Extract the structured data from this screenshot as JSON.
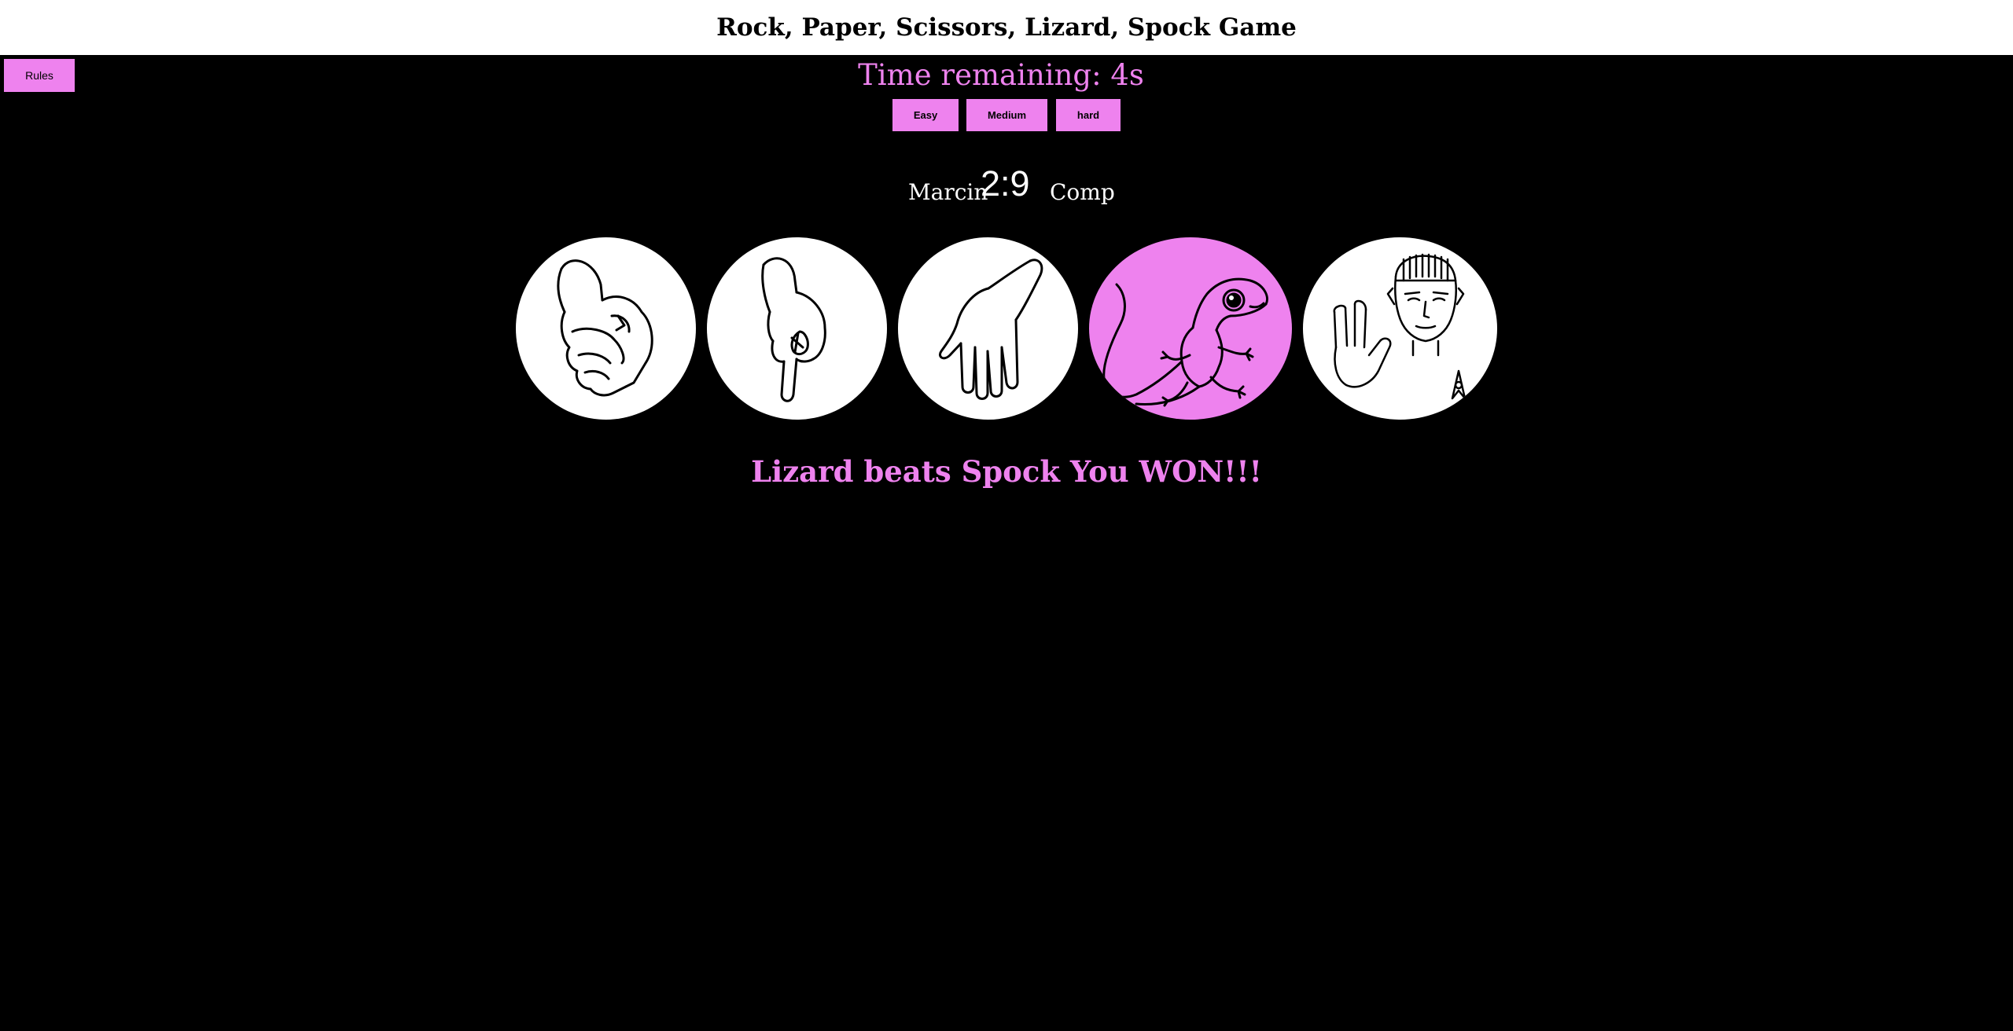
{
  "header": {
    "title": "Rock, Paper, Scissors, Lizard, Spock Game"
  },
  "rules_button": {
    "label": "Rules"
  },
  "timer": {
    "text": "Time remaining: 4s"
  },
  "difficulty": {
    "easy": "Easy",
    "medium": "Medium",
    "hard": "hard"
  },
  "scoreboard": {
    "player": "Marcin",
    "score": "2:9",
    "computer": "Comp"
  },
  "choices": [
    {
      "id": "rock",
      "icon": "fist-icon",
      "selected": false
    },
    {
      "id": "scissors",
      "icon": "scissors-hand-icon",
      "selected": false
    },
    {
      "id": "paper",
      "icon": "open-hand-icon",
      "selected": false
    },
    {
      "id": "lizard",
      "icon": "lizard-icon",
      "selected": true
    },
    {
      "id": "spock",
      "icon": "spock-icon",
      "selected": false
    }
  ],
  "result": {
    "text": "Lizard beats Spock You WON!!!"
  },
  "colors": {
    "accent": "#ee82ee",
    "background": "#000000",
    "header_bg": "#ffffff"
  }
}
